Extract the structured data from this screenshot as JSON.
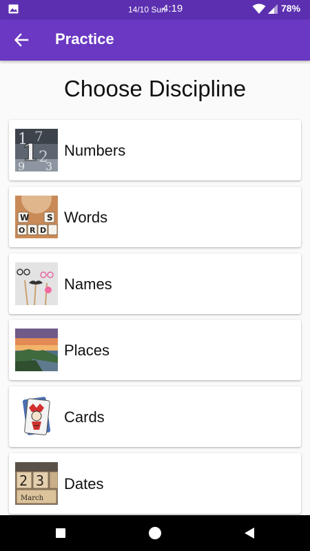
{
  "status_bar": {
    "date": "14/10 Sun",
    "time": "4:19",
    "battery": "78%"
  },
  "app_bar": {
    "title": "Practice",
    "back_icon": "arrow-left-icon"
  },
  "heading": "Choose Discipline",
  "disciplines": [
    {
      "label": "Numbers",
      "image": "numbers-thumbnail"
    },
    {
      "label": "Words",
      "image": "words-thumbnail"
    },
    {
      "label": "Names",
      "image": "names-thumbnail"
    },
    {
      "label": "Places",
      "image": "places-thumbnail"
    },
    {
      "label": "Cards",
      "image": "cards-thumbnail"
    },
    {
      "label": "Dates",
      "image": "dates-thumbnail"
    }
  ],
  "thumbnail_text": {
    "words_tiles": [
      "W",
      "S",
      "O",
      "R",
      "D"
    ],
    "dates_tiles": [
      "2",
      "3"
    ],
    "dates_month": "March"
  },
  "colors": {
    "status_bar": "#5b2fb0",
    "app_bar": "#6a38c2",
    "background": "#fafafa",
    "card": "#ffffff"
  },
  "nav_bar": {
    "recents_icon": "square-icon",
    "home_icon": "circle-icon",
    "back_icon": "triangle-back-icon"
  }
}
